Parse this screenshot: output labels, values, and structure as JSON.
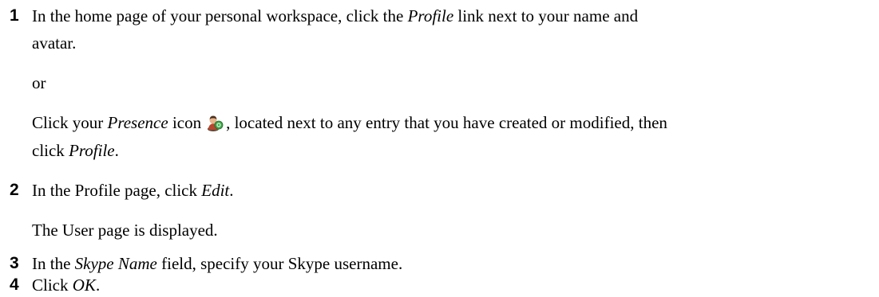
{
  "steps": [
    {
      "number": "1",
      "line1_pre": "In the home page of your personal workspace, click the ",
      "line1_em": "Profile",
      "line1_post": " link next to your name and",
      "line2": "avatar.",
      "or": "or",
      "alt_line1_pre": "Click your ",
      "alt_line1_em": "Presence",
      "alt_line1_mid": " icon",
      "alt_line1_post": ", located next to any entry that you have created or modified, then",
      "alt_line2_pre": "click ",
      "alt_line2_em": "Profile",
      "alt_line2_post": "."
    },
    {
      "number": "2",
      "line1_pre": "In the Profile page, click ",
      "line1_em": "Edit",
      "line1_post": ".",
      "result": "The User page is displayed."
    },
    {
      "number": "3",
      "line1_pre": "In the ",
      "line1_em": "Skype Name",
      "line1_post": " field, specify your Skype username."
    },
    {
      "number": "4",
      "line1_pre": "Click ",
      "line1_em": "OK",
      "line1_post": "."
    }
  ],
  "icons": {
    "presence": "presence-icon"
  }
}
